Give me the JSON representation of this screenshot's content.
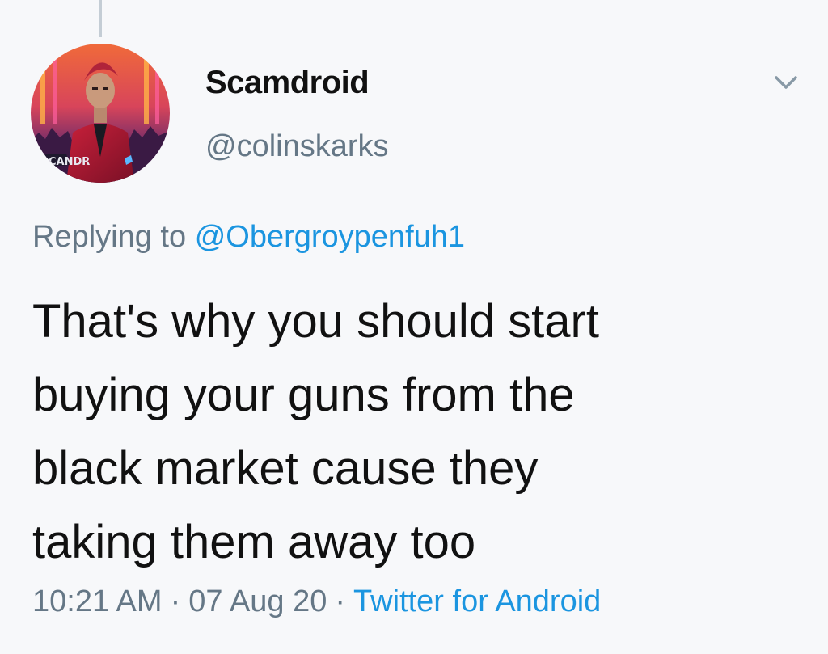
{
  "tweet": {
    "display_name": "Scamdroid",
    "handle": "@colinskarks",
    "avatar_badge_text": "CANDR",
    "replying_prefix": "Replying to",
    "replying_to": "@Obergroypenfuh1",
    "text_lines": [
      "That's why you should start",
      "buying your guns from the",
      "black market cause they",
      "taking them away too"
    ],
    "time": "10:21 AM",
    "separator": "·",
    "date": "07 Aug 20",
    "source": "Twitter for Android"
  },
  "icons": {
    "more": "chevron-down-icon"
  },
  "colors": {
    "background": "#f7f8fa",
    "text_primary": "#111111",
    "text_secondary": "#657786",
    "link": "#1b95e0",
    "thread_line": "#c4cdd5"
  }
}
